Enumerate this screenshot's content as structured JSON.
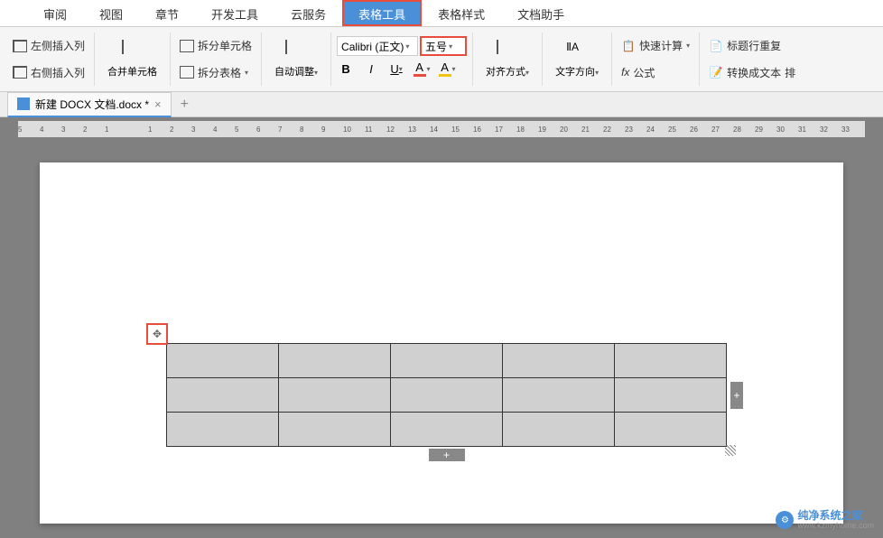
{
  "tabs": {
    "review": "审阅",
    "view": "视图",
    "chapter": "章节",
    "devtools": "开发工具",
    "cloud": "云服务",
    "table_tools": "表格工具",
    "table_style": "表格样式",
    "doc_helper": "文档助手"
  },
  "ribbon": {
    "insert_left": "左侧插入列",
    "insert_right": "右侧插入列",
    "merge_cells": "合并单元格",
    "split_cells": "拆分单元格",
    "split_table": "拆分表格",
    "auto_adjust": "自动调整",
    "font_name": "Calibri (正文)",
    "font_size": "五号",
    "bold": "B",
    "italic": "I",
    "underline": "U",
    "font_color": "A",
    "highlight": "A",
    "align": "对齐方式",
    "text_direction": "文字方向",
    "formula": "公式",
    "fx": "fx",
    "quick_calc": "快速计算",
    "header_repeat": "标题行重复",
    "convert_text": "转换成文本",
    "sort": "排"
  },
  "doc_tab": {
    "title": "新建 DOCX 文档.docx *"
  },
  "ruler": {
    "marks": [
      "5",
      "4",
      "3",
      "2",
      "1",
      "",
      "1",
      "2",
      "3",
      "4",
      "5",
      "6",
      "7",
      "8",
      "9",
      "10",
      "11",
      "12",
      "13",
      "14",
      "15",
      "16",
      "17",
      "18",
      "19",
      "20",
      "21",
      "22",
      "23",
      "24",
      "25",
      "26",
      "27",
      "28",
      "29",
      "30",
      "31",
      "32",
      "33"
    ]
  },
  "table": {
    "rows": 3,
    "cols": 5
  },
  "watermark": {
    "name": "纯净系统之家",
    "url": "www.kzmyhome.com"
  }
}
